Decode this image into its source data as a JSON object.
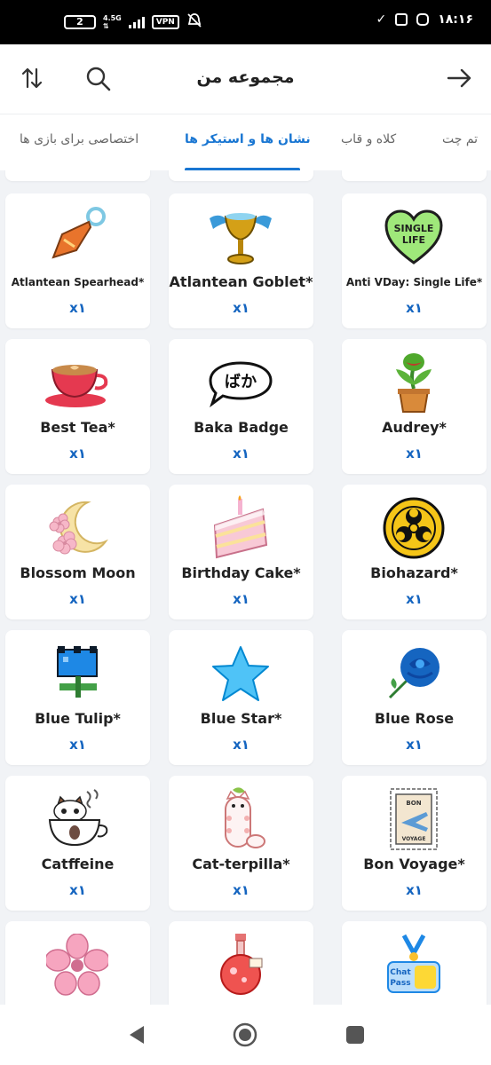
{
  "status_bar": {
    "battery": "2",
    "network": "4.5G",
    "vpn": "VPN",
    "time": "۱۸:۱۶"
  },
  "header": {
    "title": "مجموعه من",
    "icons": [
      "sort-arrows-icon",
      "search-icon",
      "back-arrow-icon"
    ]
  },
  "tabs": [
    {
      "label": "تم چت",
      "active": false
    },
    {
      "label": "کلاه و قاب",
      "active": false
    },
    {
      "label": "نشان ها و استیکر ها",
      "active": true
    },
    {
      "label": "اختصاصی برای بازی ها",
      "active": false
    }
  ],
  "accent_color": "#1976d2",
  "items": [
    {
      "name": "Atlantean Spearhead*",
      "qty": "x۱",
      "icon": "spearhead-icon"
    },
    {
      "name": "Atlantean Goblet*",
      "qty": "x۱",
      "icon": "goblet-icon"
    },
    {
      "name": "Anti VDay: Single Life*",
      "qty": "x۱",
      "icon": "single-life-heart-icon"
    },
    {
      "name": "Best Tea*",
      "qty": "x۱",
      "icon": "tea-cup-icon"
    },
    {
      "name": "Baka Badge",
      "qty": "x۱",
      "icon": "baka-speech-bubble-icon"
    },
    {
      "name": "Audrey*",
      "qty": "x۱",
      "icon": "plant-icon"
    },
    {
      "name": "Blossom Moon",
      "qty": "x۱",
      "icon": "blossom-moon-icon"
    },
    {
      "name": "Birthday Cake*",
      "qty": "x۱",
      "icon": "cake-slice-icon"
    },
    {
      "name": "Biohazard*",
      "qty": "x۱",
      "icon": "biohazard-icon"
    },
    {
      "name": "Blue Tulip*",
      "qty": "x۱",
      "icon": "pixel-tulip-icon"
    },
    {
      "name": "Blue Star*",
      "qty": "x۱",
      "icon": "star-icon"
    },
    {
      "name": "Blue Rose",
      "qty": "x۱",
      "icon": "rose-icon"
    },
    {
      "name": "Catffeine",
      "qty": "x۱",
      "icon": "cat-in-cup-icon"
    },
    {
      "name": "Cat-terpilla*",
      "qty": "x۱",
      "icon": "cat-caterpillar-icon"
    },
    {
      "name": "Bon Voyage*",
      "qty": "x۱",
      "icon": "stamp-icon"
    },
    {
      "name": "",
      "qty": "",
      "icon": "cherry-blossom-icon"
    },
    {
      "name": "",
      "qty": "",
      "icon": "potion-bottle-icon"
    },
    {
      "name": "",
      "qty": "",
      "icon": "chat-pass-medal-icon"
    }
  ]
}
